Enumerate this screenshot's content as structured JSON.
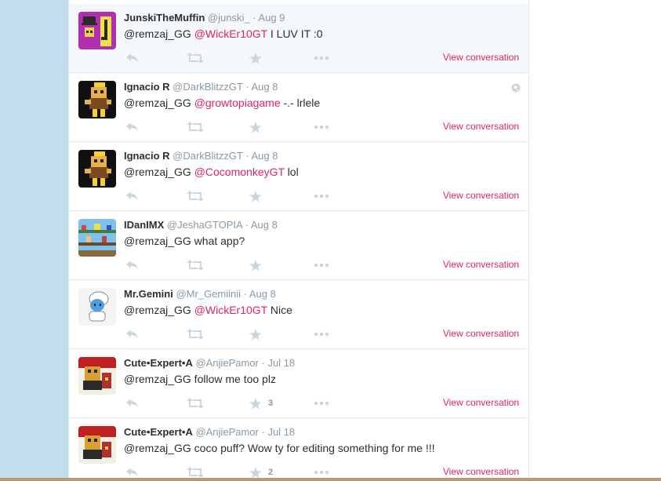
{
  "colors": {
    "link": "#e0245e",
    "page_bg": "#c0deed",
    "icon_gray": "#ccd6dd",
    "meta_gray": "#8899a6"
  },
  "view_conversation_label": "View conversation",
  "tweets": [
    {
      "fullname": "JunskiTheMuffin",
      "screen_name": "@junski_",
      "time": "Aug 9",
      "text": [
        {
          "t": "@remzaj_GG ",
          "m": false
        },
        {
          "t": "@WickEr10GT",
          "m": true
        },
        {
          "t": " I LUV IT :0",
          "m": false
        }
      ],
      "fav_count": "",
      "avatar": "purple-j-avatar",
      "globe": false
    },
    {
      "fullname": "Ignacio R",
      "screen_name": "@DarkBlitzzGT",
      "time": "Aug 8",
      "text": [
        {
          "t": "@remzaj_GG ",
          "m": false
        },
        {
          "t": "@growtopiagame",
          "m": true
        },
        {
          "t": " -.- lrlele",
          "m": false
        }
      ],
      "fav_count": "",
      "avatar": "pixel-character-avatar",
      "globe": true
    },
    {
      "fullname": "Ignacio R",
      "screen_name": "@DarkBlitzzGT",
      "time": "Aug 8",
      "text": [
        {
          "t": "@remzaj_GG ",
          "m": false
        },
        {
          "t": "@CocomonkeyGT",
          "m": true
        },
        {
          "t": " lol",
          "m": false
        }
      ],
      "fav_count": "",
      "avatar": "pixel-character-avatar",
      "globe": false
    },
    {
      "fullname": "IDanIMX",
      "screen_name": "@JeshaGTOPIA",
      "time": "Aug 8",
      "text": [
        {
          "t": "@remzaj_GG what app?",
          "m": false
        }
      ],
      "fav_count": "",
      "avatar": "game-scene-avatar",
      "globe": false
    },
    {
      "fullname": "Mr.Gemini",
      "screen_name": "@Mr_Gemiinii",
      "time": "Aug 8",
      "text": [
        {
          "t": "@remzaj_GG ",
          "m": false
        },
        {
          "t": "@WickEr10GT",
          "m": true
        },
        {
          "t": " Nice",
          "m": false
        }
      ],
      "fav_count": "",
      "avatar": "blue-character-avatar",
      "globe": false
    },
    {
      "fullname": "Cute•Expert•A",
      "screen_name": "@AnjiePamor",
      "time": "Jul 18",
      "text": [
        {
          "t": "@remzaj_GG follow me too plz",
          "m": false
        }
      ],
      "fav_count": "3",
      "avatar": "red-character-avatar",
      "globe": false
    },
    {
      "fullname": "Cute•Expert•A",
      "screen_name": "@AnjiePamor",
      "time": "Jul 18",
      "text": [
        {
          "t": "@remzaj_GG  coco puff? Wow ty for editing  something for me !!!",
          "m": false
        }
      ],
      "fav_count": "2",
      "avatar": "red-character-avatar",
      "globe": false
    }
  ]
}
